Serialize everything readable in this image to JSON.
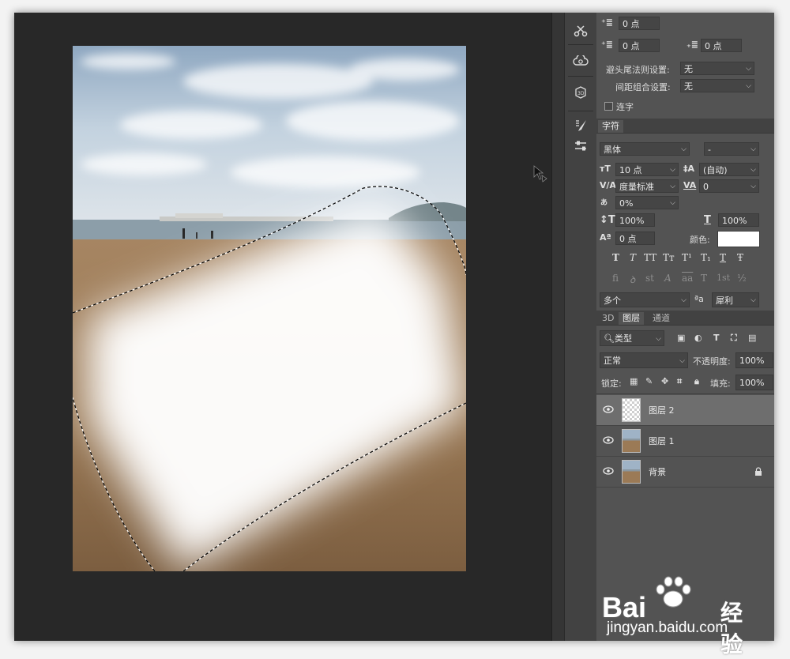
{
  "paragraph": {
    "indent_first_label": "+≡",
    "indent_first_value": "0 点",
    "space_before_value": "0 点",
    "space_after_value": "0 点",
    "kinsoku_label": "避头尾法则设置:",
    "kinsoku_value": "无",
    "mojikumi_label": "间距组合设置:",
    "mojikumi_value": "无",
    "hyphenate_label": "连字"
  },
  "character": {
    "tab": "字符",
    "font_family": "黑体",
    "font_style": "-",
    "font_size": "10 点",
    "leading": "(自动)",
    "kerning": "度量标准",
    "tracking": "0",
    "tsume": "0%",
    "vertical_scale": "100%",
    "horizontal_scale": "100%",
    "baseline_shift": "0 点",
    "color_label": "颜色:",
    "color_value": "#ffffff",
    "style_buttons": [
      "T",
      "T",
      "TT",
      "Tт",
      "T¹",
      "T₁",
      "T",
      "Ŧ"
    ],
    "opentype_buttons": [
      "fi",
      "ꝺ",
      "st",
      "A",
      "aa",
      "T",
      "1st",
      "½"
    ],
    "language": "多个",
    "aa_label": "ªa",
    "antialias": "犀利"
  },
  "layers_panel": {
    "tabs": [
      "3D",
      "图层",
      "通道"
    ],
    "active_tab": "图层",
    "filter_label": "类型",
    "blend_mode": "正常",
    "opacity_label": "不透明度:",
    "opacity_value": "100%",
    "lock_label": "锁定:",
    "fill_label": "填充:",
    "fill_value": "100%",
    "layers": [
      {
        "name": "图层 2",
        "selected": true,
        "locked": false
      },
      {
        "name": "图层 1",
        "selected": false,
        "locked": false
      },
      {
        "name": "背景",
        "selected": false,
        "locked": true
      }
    ]
  },
  "watermark": {
    "brand_left": "Bai",
    "brand_right": "经验",
    "url": "jingyan.baidu.com"
  },
  "icons": [
    "scissors-icon",
    "creative-cloud-icon",
    "3d-icon",
    "brush-settings-icon",
    "sliders-icon"
  ],
  "colors": {
    "panel": "#535353",
    "canvas_bg": "#282828",
    "selected_layer": "#6e6e6e"
  }
}
